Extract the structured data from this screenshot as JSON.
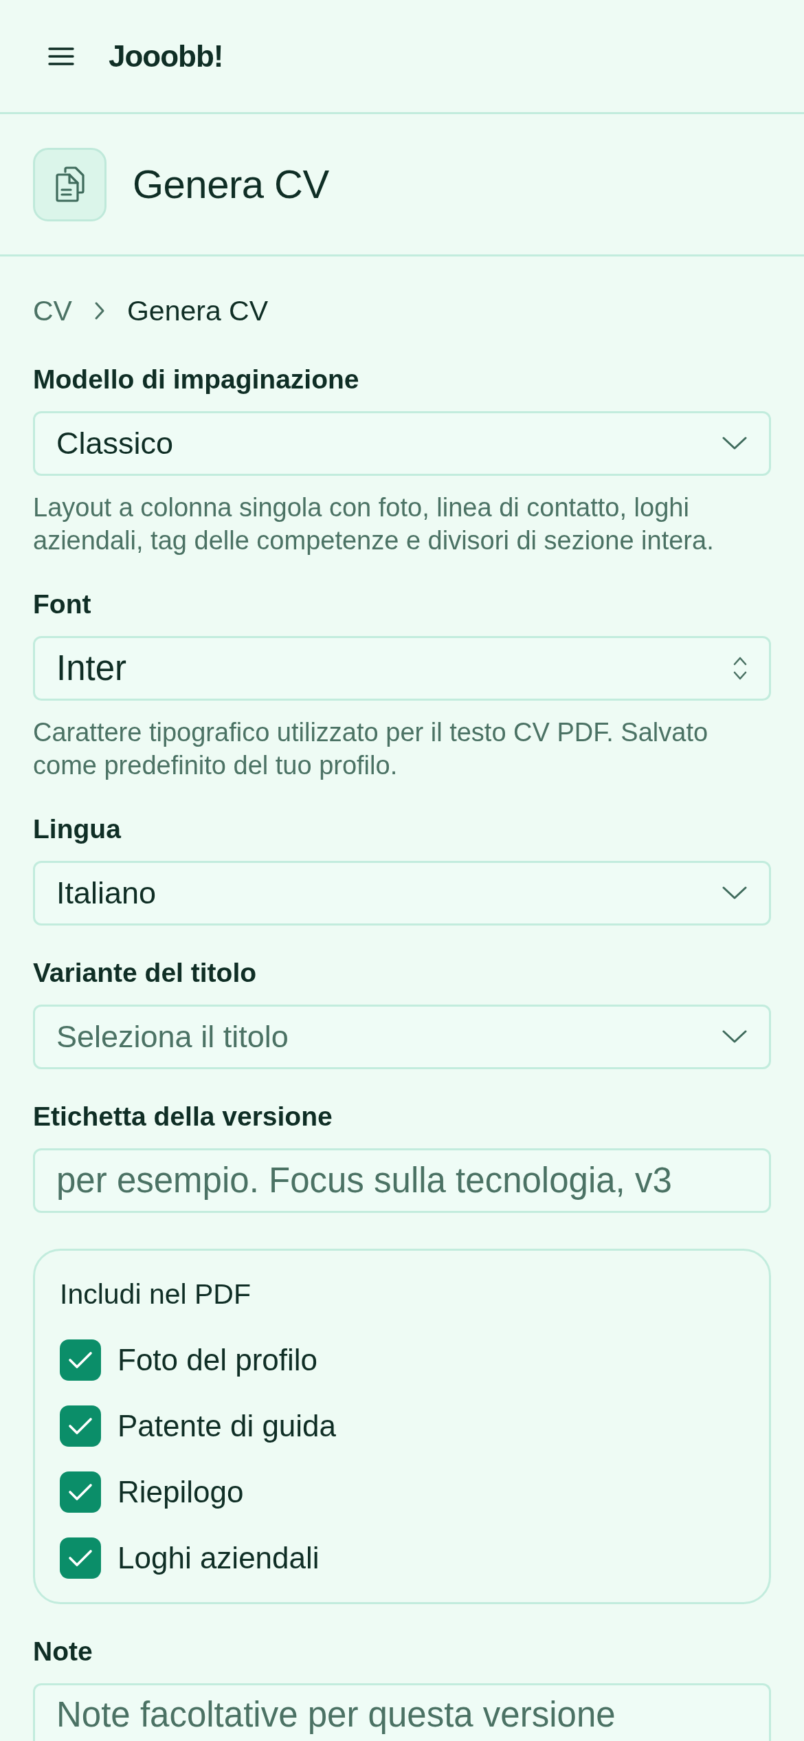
{
  "header": {
    "app_name": "Jooobb!"
  },
  "page_title": {
    "title": "Genera CV"
  },
  "breadcrumb": [
    {
      "label": "CV",
      "current": false
    },
    {
      "label": "Genera CV",
      "current": true
    }
  ],
  "fields": [
    {
      "kind": "dropdown",
      "label": "Modello di impaginazione",
      "value": "Classico",
      "help": "Layout a colonna singola con foto, linea di contatto, loghi aziendali, tag delle competenze e divisori di sezione intera."
    },
    {
      "kind": "picker",
      "label": "Font",
      "value": "Inter",
      "help": "Carattere tipografico utilizzato per il testo CV PDF. Salvato come predefinito del tuo profilo."
    },
    {
      "kind": "dropdown",
      "label": "Lingua",
      "value": "Italiano"
    },
    {
      "kind": "dropdown",
      "label": "Variante del titolo",
      "placeholder": "Seleziona il titolo"
    },
    {
      "kind": "input",
      "label": "Etichetta della versione",
      "placeholder": "per esempio. Focus sulla tecnologia, v3"
    },
    {
      "kind": "checkgroup",
      "title": "Includi nel PDF",
      "items": [
        {
          "label": "Foto del profilo",
          "checked": true
        },
        {
          "label": "Patente di guida",
          "checked": true
        },
        {
          "label": "Riepilogo",
          "checked": true
        },
        {
          "label": "Loghi aziendali",
          "checked": true
        }
      ]
    },
    {
      "kind": "textarea",
      "label": "Note",
      "placeholder": "Note facoltative per questa versione"
    }
  ]
}
